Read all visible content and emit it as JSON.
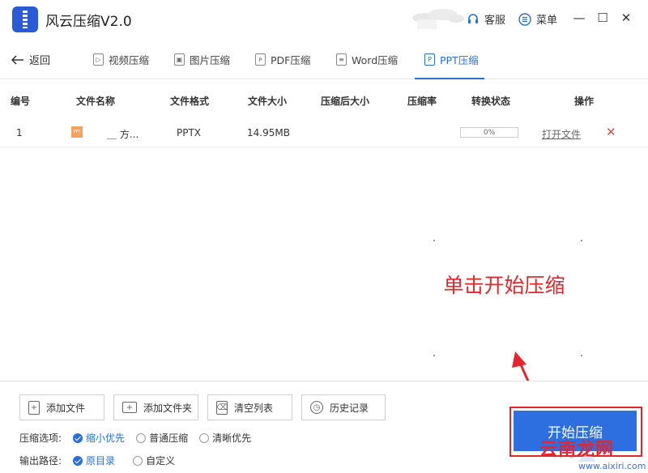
{
  "app": {
    "title": "风云压缩V2.0"
  },
  "titlebar": {
    "service_label": "客服",
    "menu_label": "菜单"
  },
  "nav": {
    "back_label": "返回",
    "tabs": [
      {
        "label": "视频压缩",
        "icon": "video-file-icon"
      },
      {
        "label": "图片压缩",
        "icon": "image-file-icon"
      },
      {
        "label": "PDF压缩",
        "icon": "pdf-file-icon"
      },
      {
        "label": "Word压缩",
        "icon": "word-file-icon"
      },
      {
        "label": "PPT压缩",
        "icon": "ppt-file-icon",
        "active": true
      }
    ]
  },
  "table": {
    "headers": [
      "编号",
      "文件名称",
      "文件格式",
      "文件大小",
      "压缩后大小",
      "压缩率",
      "转换状态",
      "操作"
    ],
    "rows": [
      {
        "index": "1",
        "icon_text": "PPT",
        "name": "＿ 方...",
        "format": "PPTX",
        "size": "14.95MB",
        "compressed_size": "",
        "ratio": "",
        "progress_text": "0%",
        "progress": 0,
        "open_label": "打开文件"
      }
    ]
  },
  "annotation": {
    "text": "单击开始压缩"
  },
  "actions": {
    "add_file": "添加文件",
    "add_folder": "添加文件夹",
    "clear_list": "清空列表",
    "history": "历史记录"
  },
  "options": {
    "compress_label": "压缩选项:",
    "compress_choices": [
      {
        "label": "缩小优先",
        "selected": true
      },
      {
        "label": "普通压缩",
        "selected": false
      },
      {
        "label": "清晰优先",
        "selected": false
      }
    ],
    "output_label": "输出路径:",
    "output_choices": [
      {
        "label": "原目录",
        "selected": true
      },
      {
        "label": "自定义",
        "selected": false
      }
    ]
  },
  "start_button": {
    "label": "开始压缩"
  },
  "watermark": {
    "main": "云南龙网",
    "sub": "www.aixiri.com"
  },
  "colors": {
    "accent": "#2d6ee0",
    "annotation": "#e4252c",
    "logo": "#2a5bd7"
  }
}
